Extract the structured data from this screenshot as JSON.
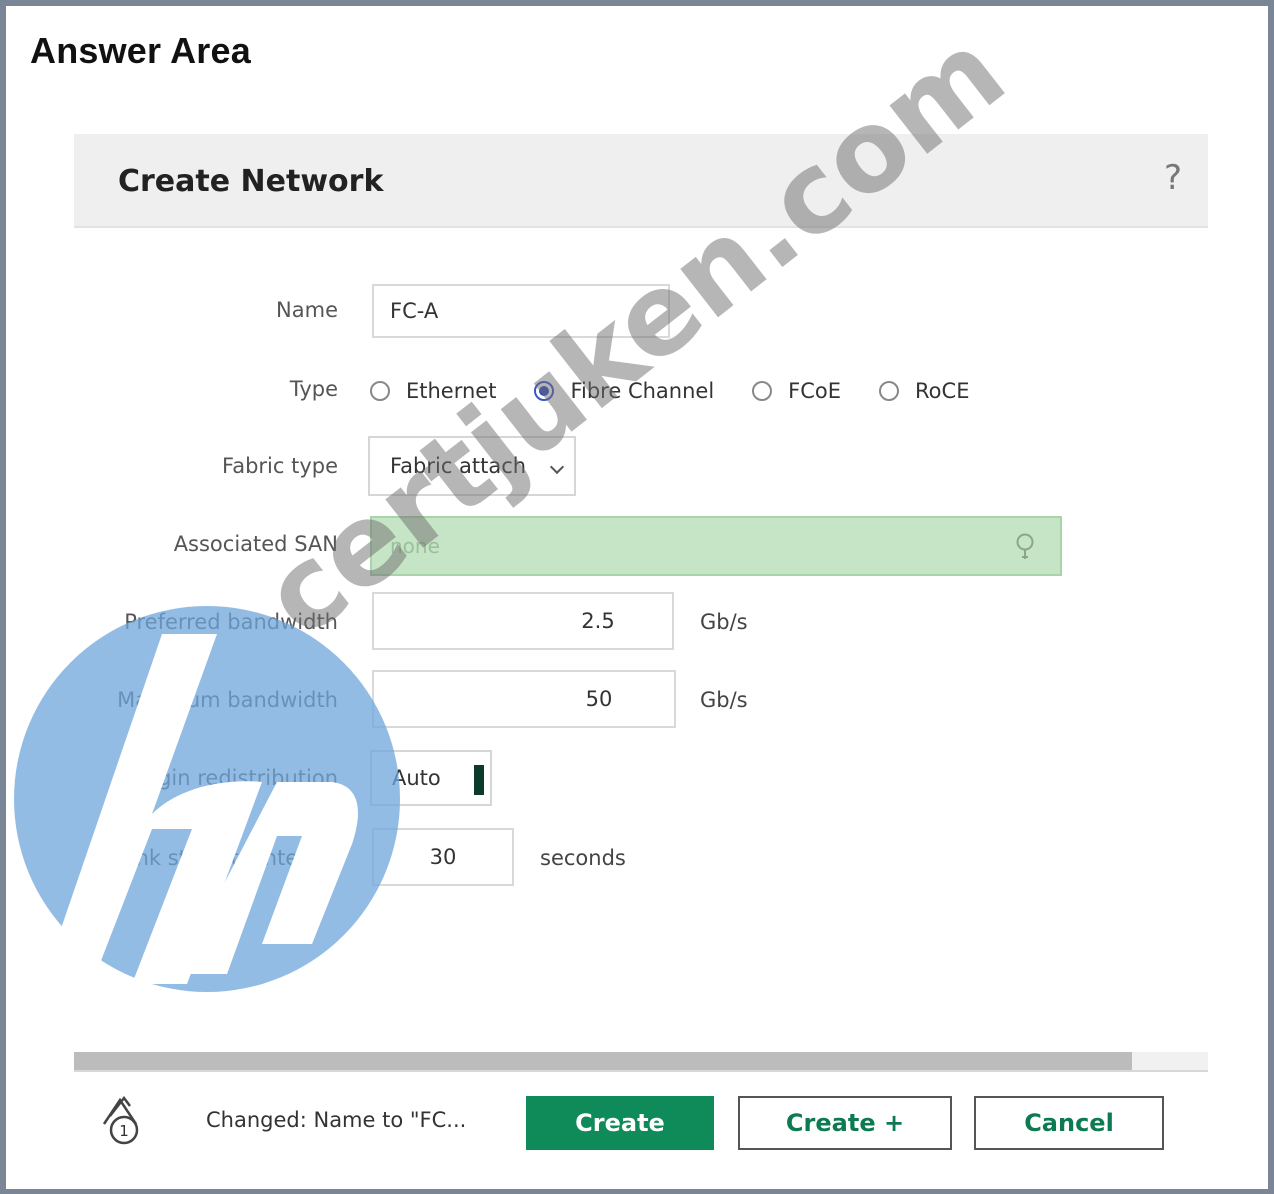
{
  "page": {
    "title": "Answer Area"
  },
  "dialog": {
    "title": "Create Network",
    "help_symbol": "?",
    "help_icon": "question-mark-icon"
  },
  "form": {
    "name": {
      "label": "Name",
      "value": "FC-A"
    },
    "type": {
      "label": "Type",
      "options": [
        {
          "label": "Ethernet",
          "selected": false
        },
        {
          "label": "Fibre Channel",
          "selected": true
        },
        {
          "label": "FCoE",
          "selected": false
        },
        {
          "label": "RoCE",
          "selected": false
        }
      ]
    },
    "fabric_type": {
      "label": "Fabric type",
      "value": "Fabric attach"
    },
    "associated_san": {
      "label": "Associated SAN",
      "placeholder": "none",
      "icon": "search-icon",
      "highlight_color": "#c6e5c6"
    },
    "preferred_bandwidth": {
      "label": "Preferred bandwidth",
      "value": "2.5",
      "unit": "Gb/s"
    },
    "maximum_bandwidth": {
      "label": "Maximum bandwidth",
      "value": "50",
      "unit": "Gb/s"
    },
    "login_redistribution": {
      "label": "Login redistribution",
      "value": "Auto"
    },
    "link_stability_interval": {
      "label": "Link stability interval",
      "value": "30",
      "unit": "seconds"
    }
  },
  "footer": {
    "history_icon": "history-icon",
    "history_count": "1",
    "changed_text": "Changed: Name to \"FC...",
    "buttons": {
      "create": "Create",
      "create_plus": "Create +",
      "cancel": "Cancel"
    },
    "primary_color": "#0e8b58"
  },
  "watermark": {
    "text": "certjuken.com",
    "logo": "hp-logo",
    "logo_color": "#6fa6dc"
  }
}
